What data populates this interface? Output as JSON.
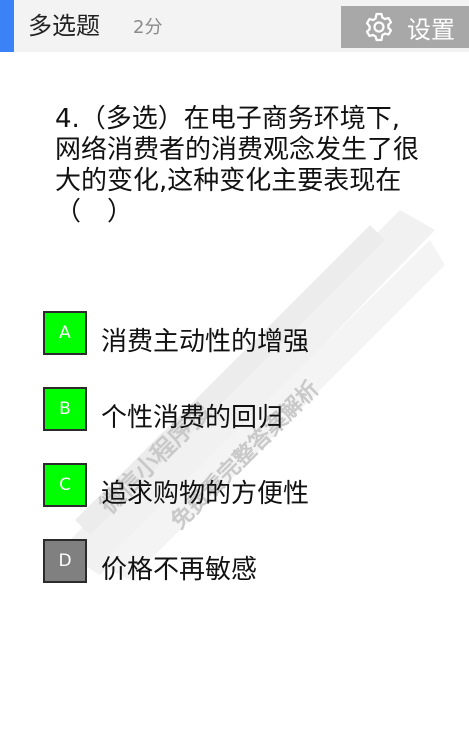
{
  "header": {
    "title": "多选题",
    "score": "2分",
    "settings_label": "设置",
    "accent_color": "#3b82f6"
  },
  "question": {
    "text": "4.（多选）在电子商务环境下,网络消费者的消费观念发生了很大的变化,这种变化主要表现在（　）"
  },
  "options": [
    {
      "letter": "A",
      "text": "消费主动性的增强",
      "color": "#00ff00"
    },
    {
      "letter": "B",
      "text": "个性消费的回归",
      "color": "#00ff00"
    },
    {
      "letter": "C",
      "text": "追求购物的方便性",
      "color": "#00ff00"
    },
    {
      "letter": "D",
      "text": "价格不再敏感",
      "color": "#808080"
    }
  ],
  "watermark": {
    "line1": "微信小程序搜",
    "line2": "免费看完整答案解析"
  },
  "icons": {
    "settings": "gear-icon"
  }
}
